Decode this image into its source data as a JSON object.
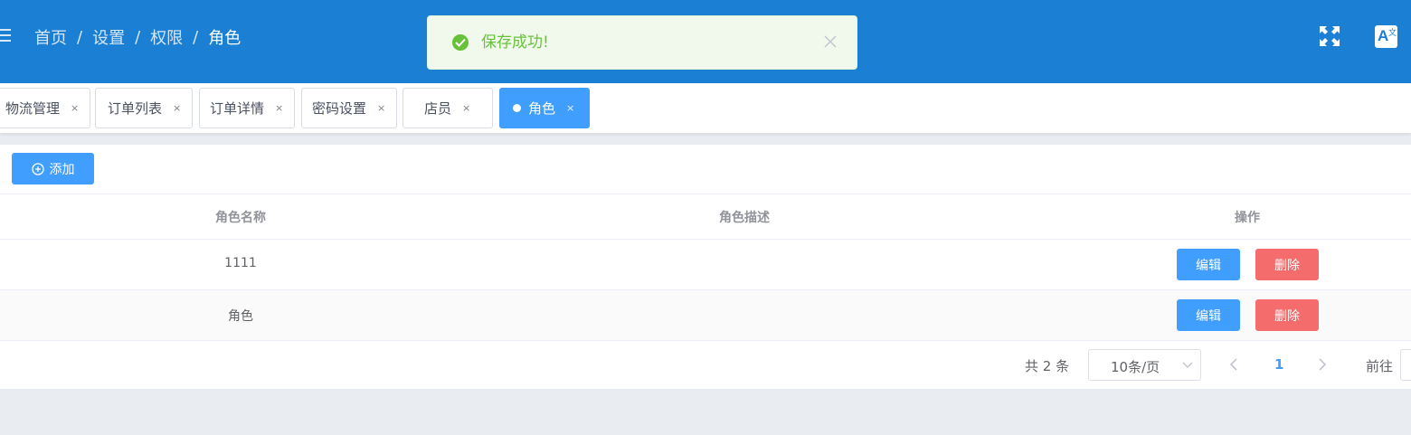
{
  "breadcrumb": {
    "items": [
      "首页",
      "设置",
      "权限"
    ],
    "current": "角色",
    "separator": "/"
  },
  "toast": {
    "message": "保存成功!",
    "type": "success",
    "color": "#67c23a"
  },
  "header": {
    "background": "#1b80d4",
    "icons": [
      "hamburger-icon",
      "fullscreen-icon",
      "translate-icon"
    ],
    "lang_icon_text_a": "A",
    "lang_icon_text_zh": "文"
  },
  "tabs": [
    {
      "label": "物流管理",
      "close": "×",
      "active": false
    },
    {
      "label": "订单列表",
      "close": "×",
      "active": false
    },
    {
      "label": "订单详情",
      "close": "×",
      "active": false
    },
    {
      "label": "密码设置",
      "close": "×",
      "active": false
    },
    {
      "label": "店员",
      "close": "×",
      "active": false
    },
    {
      "label": "角色",
      "close": "×",
      "active": true
    }
  ],
  "toolbar": {
    "add_label": "添加",
    "accent": "#409eff"
  },
  "table": {
    "columns": [
      "角色名称",
      "角色描述",
      "操作"
    ],
    "rows": [
      {
        "name": "1111",
        "description": "",
        "edit_label": "编辑",
        "delete_label": "删除"
      },
      {
        "name": "角色",
        "description": "",
        "edit_label": "编辑",
        "delete_label": "删除"
      }
    ],
    "danger_color": "#f56c6c"
  },
  "pagination": {
    "total_text": "共 2 条",
    "page_size": "10条/页",
    "current_page": "1",
    "goto_label": "前往"
  }
}
